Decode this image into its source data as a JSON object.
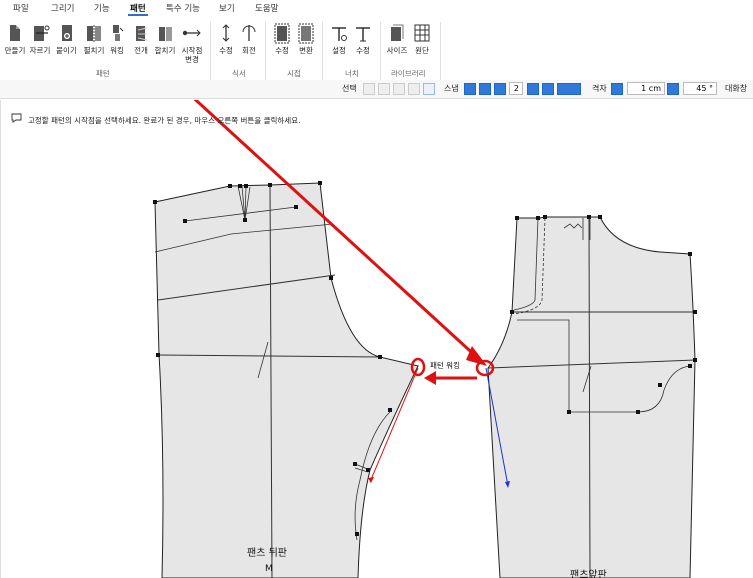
{
  "menu": [
    {
      "label": "파일"
    },
    {
      "label": "그리기"
    },
    {
      "label": "기능"
    },
    {
      "label": "패턴",
      "active": true
    },
    {
      "label": "특수 기능"
    },
    {
      "label": "보기"
    },
    {
      "label": "도움말"
    }
  ],
  "ribbon": {
    "buttons": [
      {
        "label": "만들기",
        "icon": "make-icon"
      },
      {
        "label": "자르기",
        "icon": "cut-icon"
      },
      {
        "label": "붙이기",
        "icon": "attach-icon"
      },
      {
        "label": "펼치기",
        "icon": "unfold-icon"
      },
      {
        "label": "워킹",
        "icon": "walking-icon",
        "highlighted": true
      },
      {
        "label": "전개",
        "icon": "spread-icon"
      },
      {
        "label": "합치기",
        "icon": "merge-icon"
      },
      {
        "label": "시작점\n변경",
        "icon": "start-point-icon"
      },
      {
        "label": "수정",
        "icon": "edit-icon"
      },
      {
        "label": "회전",
        "icon": "rotate-icon"
      },
      {
        "label": "수정",
        "icon": "edit-icon"
      },
      {
        "label": "변환",
        "icon": "convert-icon"
      },
      {
        "label": "설정",
        "icon": "notch-set-icon"
      },
      {
        "label": "수정",
        "icon": "notch-edit-icon"
      },
      {
        "label": "사이즈",
        "icon": "size-icon"
      },
      {
        "label": "원단",
        "icon": "fabric-icon"
      }
    ],
    "groups": [
      {
        "label": "패턴"
      },
      {
        "label": "식서"
      },
      {
        "label": "시접"
      },
      {
        "label": "너치"
      },
      {
        "label": "라이브러리"
      }
    ]
  },
  "toolbar2": {
    "select_label": "선택",
    "snap_label": "스냅",
    "snap_value": "2",
    "grid_label": "격자",
    "grid_value": "1 cm",
    "angle_value": "45 °",
    "dialog_label": "대화창"
  },
  "hint": "고정할 패턴의 시작점을 선택하세요. 완료가 된 경우, 마우스 오른쪽 버튼을 클릭하세요.",
  "canvas": {
    "annotation": "패턴 워킹",
    "back_piece_name": "팬츠 뒤판",
    "back_piece_size": "M",
    "front_piece_name": "팬츠앞판",
    "colors": {
      "highlight": "#e01010",
      "pattern_fill": "#e6e6e6",
      "pattern_line": "#222222",
      "blue_line": "#1a34d8"
    }
  }
}
